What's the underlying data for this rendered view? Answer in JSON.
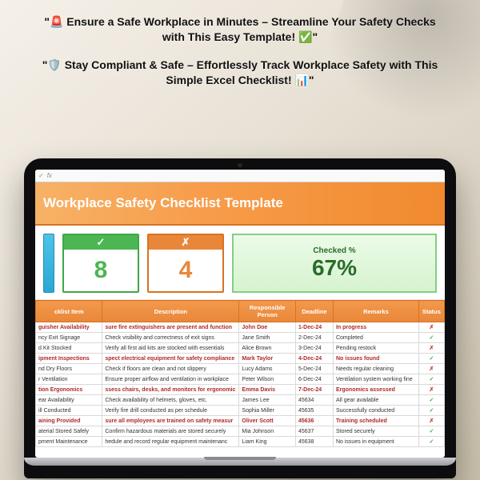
{
  "headlines": {
    "line1": "\"🚨 Ensure a Safe Workplace in Minutes – Streamline Your Safety Checks with This Easy Template! ✅\"",
    "line2": "\"🛡️ Stay Compliant & Safe – Effortlessly Track Workplace Safety with This Simple Excel Checklist! 📊\""
  },
  "fx": {
    "check": "✓",
    "label": "fx"
  },
  "title": "Workplace Safety Checklist Template",
  "cards": {
    "ok": {
      "mark": "✓",
      "value": "8"
    },
    "bad": {
      "mark": "✗",
      "value": "4"
    },
    "pct": {
      "label": "Checked %",
      "value": "67%"
    }
  },
  "columns": [
    "cklist Item",
    "Description",
    "Responsible Person",
    "Deadline",
    "Remarks",
    "Status"
  ],
  "rows": [
    {
      "item": "guisher Availability",
      "desc": "sure fire extinguishers are present and function",
      "person": "John Doe",
      "deadline": "1-Dec-24",
      "remarks": "In progress",
      "red": true,
      "ok": false
    },
    {
      "item": "ncy Exit Signage",
      "desc": "Check visibility and correctness of exit signs",
      "person": "Jane Smith",
      "deadline": "2-Dec-24",
      "remarks": "Completed",
      "red": false,
      "ok": true
    },
    {
      "item": "d Kit Stocked",
      "desc": "Verify all first aid kits are stocked with essentials",
      "person": "Alice Brown",
      "deadline": "3-Dec-24",
      "remarks": "Pending restock",
      "red": false,
      "ok": false
    },
    {
      "item": "ipment Inspections",
      "desc": "spect electrical equipment for safety compliance",
      "person": "Mark Taylor",
      "deadline": "4-Dec-24",
      "remarks": "No issues found",
      "red": true,
      "ok": true
    },
    {
      "item": "nd Dry Floors",
      "desc": "Check if floors are clean and not slippery",
      "person": "Lucy Adams",
      "deadline": "5-Dec-24",
      "remarks": "Needs regular cleaning",
      "red": false,
      "ok": false
    },
    {
      "item": "r Ventilation",
      "desc": "Ensure proper airflow and ventilation in workplace",
      "person": "Peter Wilson",
      "deadline": "6-Dec-24",
      "remarks": "Ventilation system working fine",
      "red": false,
      "ok": true
    },
    {
      "item": "tion Ergonomics",
      "desc": "ssess chairs, desks, and monitors for ergonomic",
      "person": "Emma Davis",
      "deadline": "7-Dec-24",
      "remarks": "Ergonomics assessed",
      "red": true,
      "ok": false
    },
    {
      "item": "ear Availability",
      "desc": "Check availability of helmets, gloves, etc.",
      "person": "James Lee",
      "deadline": "45634",
      "remarks": "All gear available",
      "red": false,
      "ok": true
    },
    {
      "item": "ill Conducted",
      "desc": "Verify fire drill conducted as per schedule",
      "person": "Sophia Miller",
      "deadline": "45635",
      "remarks": "Successfully conducted",
      "red": false,
      "ok": true
    },
    {
      "item": "aining Provided",
      "desc": "sure all employees are trained on safety measur",
      "person": "Oliver Scott",
      "deadline": "45636",
      "remarks": "Training scheduled",
      "red": true,
      "ok": false
    },
    {
      "item": "aterial Stored Safely",
      "desc": "Confirm hazardous materials are stored securely",
      "person": "Mia Johnson",
      "deadline": "45637",
      "remarks": "Stored securely",
      "red": false,
      "ok": true
    },
    {
      "item": "pment Maintenance",
      "desc": "hedule and record regular equipment maintenanc",
      "person": "Liam King",
      "deadline": "45638",
      "remarks": "No issues in equipment",
      "red": false,
      "ok": true
    }
  ],
  "marks": {
    "ok": "✓",
    "bad": "✗"
  }
}
